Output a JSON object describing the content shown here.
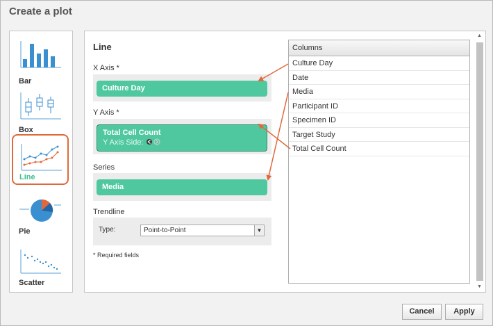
{
  "dialog": {
    "title": "Create a plot"
  },
  "colors": {
    "accent": "#4fc8a0",
    "selection": "#e0683a",
    "selected_label": "#3fbf8f"
  },
  "plot_types": [
    {
      "label": "Bar",
      "icon": "bar-chart-icon"
    },
    {
      "label": "Box",
      "icon": "box-plot-icon"
    },
    {
      "label": "Line",
      "icon": "line-chart-icon",
      "selected": true
    },
    {
      "label": "Pie",
      "icon": "pie-chart-icon"
    },
    {
      "label": "Scatter",
      "icon": "scatter-plot-icon"
    }
  ],
  "config": {
    "title": "Line",
    "x_axis": {
      "label": "X Axis *",
      "value": "Culture Day"
    },
    "y_axis": {
      "label": "Y Axis *",
      "value": "Total Cell Count",
      "side_label": "Y Axis Side:"
    },
    "series": {
      "label": "Series",
      "value": "Media"
    },
    "trendline": {
      "label": "Trendline",
      "type_label": "Type:",
      "value": "Point-to-Point"
    },
    "required_note": "* Required fields"
  },
  "columns": {
    "header": "Columns",
    "items": [
      "Culture Day",
      "Date",
      "Media",
      "Participant ID",
      "Specimen ID",
      "Target Study",
      "Total Cell Count"
    ]
  },
  "buttons": {
    "cancel": "Cancel",
    "apply": "Apply"
  }
}
